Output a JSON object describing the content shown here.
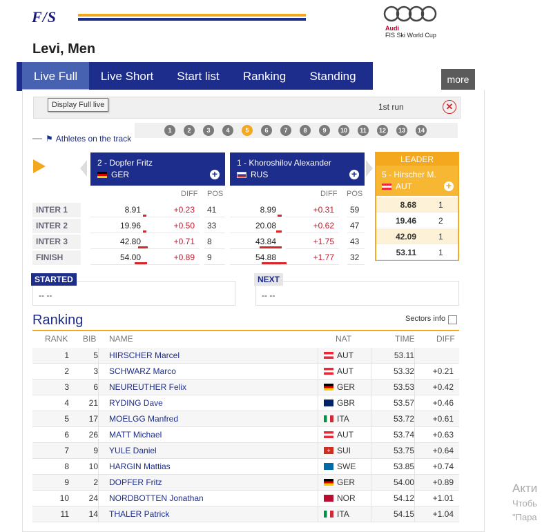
{
  "header": {
    "logo": "F/S",
    "sponsor_brand": "Audi",
    "sponsor_event": "FIS Ski World Cup",
    "title": "Levi, Men"
  },
  "nav": {
    "tabs": [
      "Live Full",
      "Live Short",
      "Start list",
      "Ranking",
      "Standing"
    ],
    "active": "Live Full",
    "more": "more"
  },
  "runbar": {
    "tooltip": "Display Full live",
    "run": "1st run",
    "close_icon": "close-circle-icon"
  },
  "track": {
    "label": "Athletes on the track",
    "bibs": [
      "1",
      "2",
      "3",
      "4",
      "5",
      "6",
      "7",
      "8",
      "9",
      "10",
      "11",
      "12",
      "13",
      "14"
    ],
    "selected_bib": "5"
  },
  "compare": {
    "split_labels": [
      "INTER 1",
      "INTER 2",
      "INTER 3",
      "FINISH"
    ],
    "col_diff": "DIFF",
    "col_pos": "POS",
    "athletes": [
      {
        "name": "2 - Dopfer Fritz",
        "nat": "GER",
        "times": [
          "8.91",
          "19.96",
          "42.80",
          "54.00"
        ],
        "diffs": [
          "+0.23",
          "+0.50",
          "+0.71",
          "+0.89"
        ],
        "pos": [
          "41",
          "33",
          "8",
          "9"
        ]
      },
      {
        "name": "1 - Khoroshilov Alexander",
        "nat": "RUS",
        "times": [
          "8.99",
          "20.08",
          "43.84",
          "54.88"
        ],
        "diffs": [
          "+0.31",
          "+0.62",
          "+1.75",
          "+1.77"
        ],
        "pos": [
          "59",
          "47",
          "43",
          "32"
        ]
      }
    ],
    "leader": {
      "title": "LEADER",
      "name": "5 - Hirscher M.",
      "nat": "AUT",
      "times": [
        "8.68",
        "19.46",
        "42.09",
        "53.11"
      ],
      "pos": [
        "1",
        "2",
        "1",
        "1"
      ]
    }
  },
  "started": {
    "title": "STARTED",
    "value": "-- --"
  },
  "next": {
    "title": "NEXT",
    "value": "-- --"
  },
  "ranking": {
    "title": "Ranking",
    "sectors_label": "Sectors info",
    "columns": [
      "RANK",
      "BIB",
      "NAME",
      "NAT",
      "TIME",
      "DIFF"
    ],
    "rows": [
      {
        "rank": "1",
        "bib": "5",
        "name": "HIRSCHER Marcel",
        "nat": "AUT",
        "time": "53.11",
        "diff": ""
      },
      {
        "rank": "2",
        "bib": "3",
        "name": "SCHWARZ Marco",
        "nat": "AUT",
        "time": "53.32",
        "diff": "+0.21"
      },
      {
        "rank": "3",
        "bib": "6",
        "name": "NEUREUTHER Felix",
        "nat": "GER",
        "time": "53.53",
        "diff": "+0.42"
      },
      {
        "rank": "4",
        "bib": "21",
        "name": "RYDING Dave",
        "nat": "GBR",
        "time": "53.57",
        "diff": "+0.46"
      },
      {
        "rank": "5",
        "bib": "17",
        "name": "MOELGG Manfred",
        "nat": "ITA",
        "time": "53.72",
        "diff": "+0.61"
      },
      {
        "rank": "6",
        "bib": "26",
        "name": "MATT Michael",
        "nat": "AUT",
        "time": "53.74",
        "diff": "+0.63"
      },
      {
        "rank": "7",
        "bib": "9",
        "name": "YULE Daniel",
        "nat": "SUI",
        "time": "53.75",
        "diff": "+0.64"
      },
      {
        "rank": "8",
        "bib": "10",
        "name": "HARGIN Mattias",
        "nat": "SWE",
        "time": "53.85",
        "diff": "+0.74"
      },
      {
        "rank": "9",
        "bib": "2",
        "name": "DOPFER Fritz",
        "nat": "GER",
        "time": "54.00",
        "diff": "+0.89"
      },
      {
        "rank": "10",
        "bib": "24",
        "name": "NORDBOTTEN Jonathan",
        "nat": "NOR",
        "time": "54.12",
        "diff": "+1.01"
      },
      {
        "rank": "11",
        "bib": "14",
        "name": "THALER Patrick",
        "nat": "ITA",
        "time": "54.15",
        "diff": "+1.04"
      }
    ]
  },
  "watermark": [
    "Акти",
    "Чтобь",
    "\"Пара"
  ],
  "colors": {
    "navy": "#1d2d8c",
    "orange": "#f3a81d",
    "red": "#c2182c"
  }
}
